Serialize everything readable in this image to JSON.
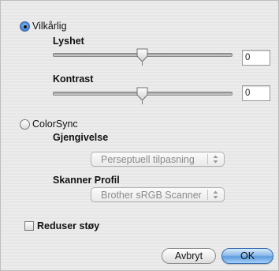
{
  "vilkarlig": {
    "label": "Vilkårlig",
    "selected": true,
    "lyshet": {
      "label": "Lyshet",
      "value": "0",
      "slider_position": 0.5
    },
    "kontrast": {
      "label": "Kontrast",
      "value": "0",
      "slider_position": 0.5
    }
  },
  "colorsync": {
    "label": "ColorSync",
    "selected": false,
    "gjengivelse": {
      "label": "Gjengivelse",
      "selected_option": "Perseptuell tilpasning"
    },
    "skanner_profil": {
      "label": "Skanner Profil",
      "selected_option": "Brother sRGB Scanner"
    }
  },
  "reduser_stoy": {
    "label": "Reduser støy",
    "checked": false
  },
  "buttons": {
    "cancel_label": "Avbryt",
    "ok_label": "OK"
  },
  "colors": {
    "accent": "#5e9be0",
    "radio_selected": "#4f8ed8",
    "background": "#e8e8e8"
  },
  "icons": {
    "slider_thumb": "slider-thumb-icon",
    "popup_arrows": "updown-arrows-icon"
  }
}
